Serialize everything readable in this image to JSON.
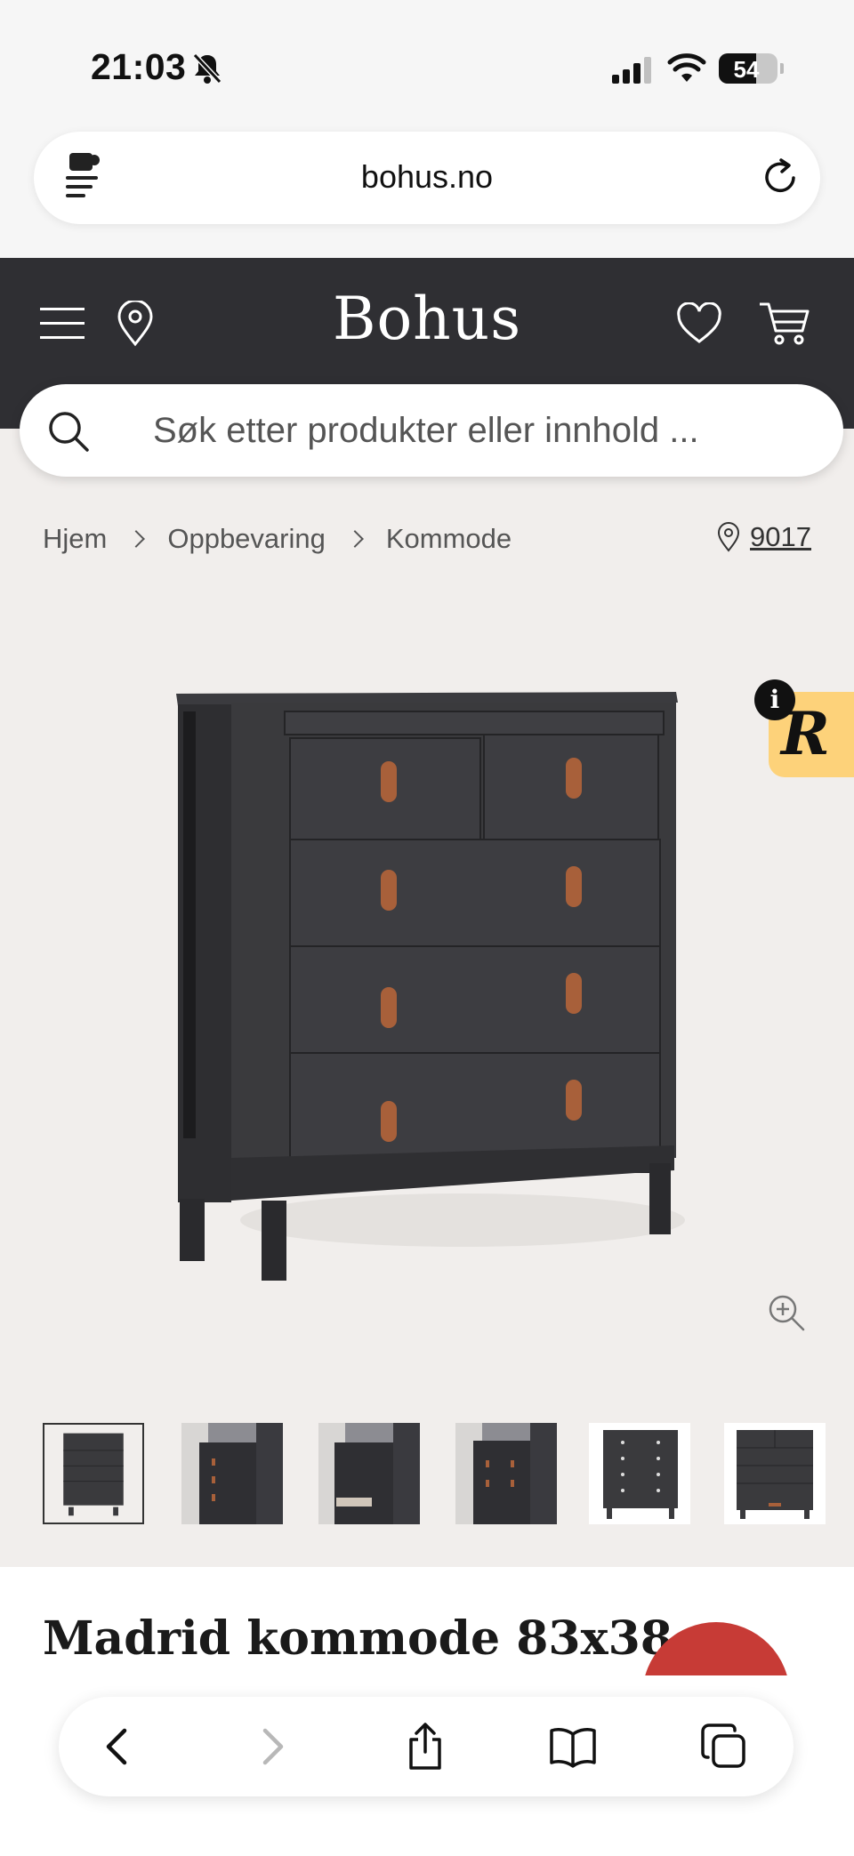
{
  "status_bar": {
    "time": "21:03",
    "battery": "54",
    "icons": [
      "bell-slash-icon",
      "cellular-signal-icon",
      "wifi-icon",
      "battery-icon"
    ]
  },
  "browser": {
    "url": "bohus.no",
    "icons": [
      "reader-mode-icon",
      "reload-icon"
    ]
  },
  "header": {
    "logo": "Bohus",
    "colors": {
      "background": "#2f2f33",
      "text": "#ffffff"
    },
    "icons": [
      "menu-icon",
      "location-pin-icon",
      "heart-icon",
      "cart-icon"
    ]
  },
  "search": {
    "placeholder": "Søk etter produkter eller innhold ..."
  },
  "breadcrumb": {
    "items": [
      "Hjem",
      "Oppbevaring",
      "Kommode"
    ],
    "location_zip": "9017"
  },
  "gallery": {
    "rating_badge_letter": "R",
    "info_label": "i",
    "thumbnail_count": 6,
    "active_thumbnail": 1
  },
  "product": {
    "title": "Madrid kommode 83x38",
    "accent_color": "#c73b36"
  },
  "toolbar": {
    "icons": [
      "back-icon",
      "forward-icon",
      "share-icon",
      "bookmarks-icon",
      "tabs-icon"
    ]
  }
}
